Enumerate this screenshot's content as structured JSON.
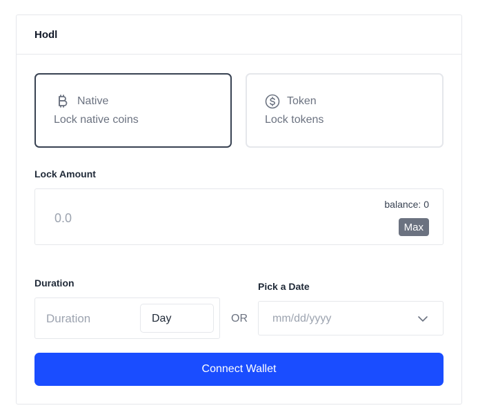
{
  "card": {
    "title": "Hodl"
  },
  "lock_type": {
    "selected": "native",
    "options": [
      {
        "id": "native",
        "label": "Native",
        "description": "Lock native coins",
        "icon": "bitcoin-icon"
      },
      {
        "id": "token",
        "label": "Token",
        "description": "Lock tokens",
        "icon": "dollar-coin-icon"
      }
    ]
  },
  "amount": {
    "label": "Lock Amount",
    "placeholder": "0.0",
    "balance_text": "balance: 0",
    "max_label": "Max"
  },
  "duration": {
    "label": "Duration",
    "placeholder": "Duration",
    "unit": "Day"
  },
  "or_text": "OR",
  "date": {
    "label": "Pick a Date",
    "placeholder": "mm/dd/yyyy",
    "icon": "chevron-down-icon"
  },
  "connect_label": "Connect Wallet",
  "colors": {
    "primary": "#1a4dff",
    "selected_border": "#374151",
    "muted_text": "#6b7280",
    "max_button": "#6b7280",
    "border": "#e5e7eb"
  }
}
